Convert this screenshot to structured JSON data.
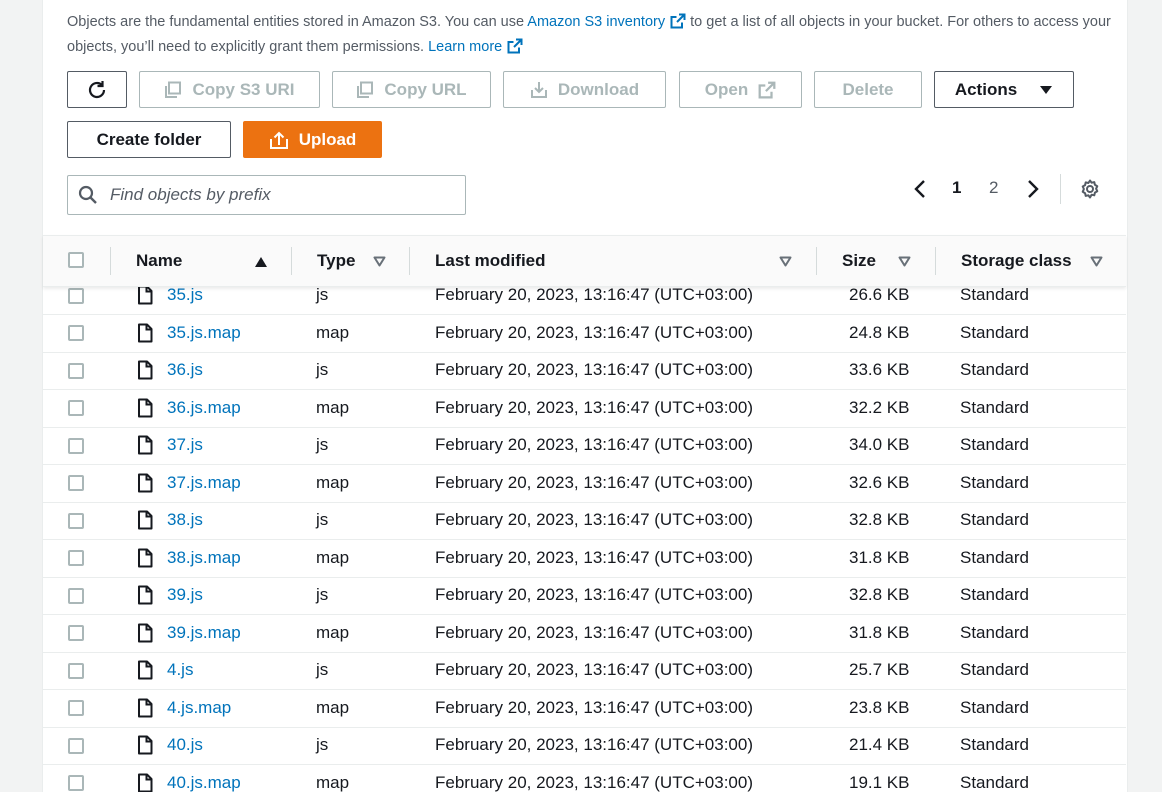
{
  "description": {
    "text1": "Objects are the fundamental entities stored in Amazon S3. You can use",
    "inventory_link": "Amazon S3 inventory",
    "text2": "to get a list of all objects in your bucket. For others to access your objects, you’ll need to explicitly grant them permissions.",
    "learn_more": "Learn more"
  },
  "toolbar": {
    "copy_s3_uri": "Copy S3 URI",
    "copy_url": "Copy URL",
    "download": "Download",
    "open": "Open",
    "delete": "Delete",
    "actions": "Actions",
    "create_folder": "Create folder",
    "upload": "Upload"
  },
  "search": {
    "placeholder": "Find objects by prefix",
    "value": ""
  },
  "pagination": {
    "current": "1",
    "next": "2"
  },
  "table": {
    "columns": {
      "name": "Name",
      "type": "Type",
      "last_modified": "Last modified",
      "size": "Size",
      "storage_class": "Storage class"
    },
    "rows": [
      {
        "name": "35.js",
        "type": "js",
        "last_modified": "February 20, 2023, 13:16:47 (UTC+03:00)",
        "size": "26.6 KB",
        "storage_class": "Standard"
      },
      {
        "name": "35.js.map",
        "type": "map",
        "last_modified": "February 20, 2023, 13:16:47 (UTC+03:00)",
        "size": "24.8 KB",
        "storage_class": "Standard"
      },
      {
        "name": "36.js",
        "type": "js",
        "last_modified": "February 20, 2023, 13:16:47 (UTC+03:00)",
        "size": "33.6 KB",
        "storage_class": "Standard"
      },
      {
        "name": "36.js.map",
        "type": "map",
        "last_modified": "February 20, 2023, 13:16:47 (UTC+03:00)",
        "size": "32.2 KB",
        "storage_class": "Standard"
      },
      {
        "name": "37.js",
        "type": "js",
        "last_modified": "February 20, 2023, 13:16:47 (UTC+03:00)",
        "size": "34.0 KB",
        "storage_class": "Standard"
      },
      {
        "name": "37.js.map",
        "type": "map",
        "last_modified": "February 20, 2023, 13:16:47 (UTC+03:00)",
        "size": "32.6 KB",
        "storage_class": "Standard"
      },
      {
        "name": "38.js",
        "type": "js",
        "last_modified": "February 20, 2023, 13:16:47 (UTC+03:00)",
        "size": "32.8 KB",
        "storage_class": "Standard"
      },
      {
        "name": "38.js.map",
        "type": "map",
        "last_modified": "February 20, 2023, 13:16:47 (UTC+03:00)",
        "size": "31.8 KB",
        "storage_class": "Standard"
      },
      {
        "name": "39.js",
        "type": "js",
        "last_modified": "February 20, 2023, 13:16:47 (UTC+03:00)",
        "size": "32.8 KB",
        "storage_class": "Standard"
      },
      {
        "name": "39.js.map",
        "type": "map",
        "last_modified": "February 20, 2023, 13:16:47 (UTC+03:00)",
        "size": "31.8 KB",
        "storage_class": "Standard"
      },
      {
        "name": "4.js",
        "type": "js",
        "last_modified": "February 20, 2023, 13:16:47 (UTC+03:00)",
        "size": "25.7 KB",
        "storage_class": "Standard"
      },
      {
        "name": "4.js.map",
        "type": "map",
        "last_modified": "February 20, 2023, 13:16:47 (UTC+03:00)",
        "size": "23.8 KB",
        "storage_class": "Standard"
      },
      {
        "name": "40.js",
        "type": "js",
        "last_modified": "February 20, 2023, 13:16:47 (UTC+03:00)",
        "size": "21.4 KB",
        "storage_class": "Standard"
      },
      {
        "name": "40.js.map",
        "type": "map",
        "last_modified": "February 20, 2023, 13:16:47 (UTC+03:00)",
        "size": "19.1 KB",
        "storage_class": "Standard"
      }
    ]
  },
  "colors": {
    "link": "#0073bb",
    "primary": "#ec7211",
    "disabled": "#aab7b8"
  }
}
